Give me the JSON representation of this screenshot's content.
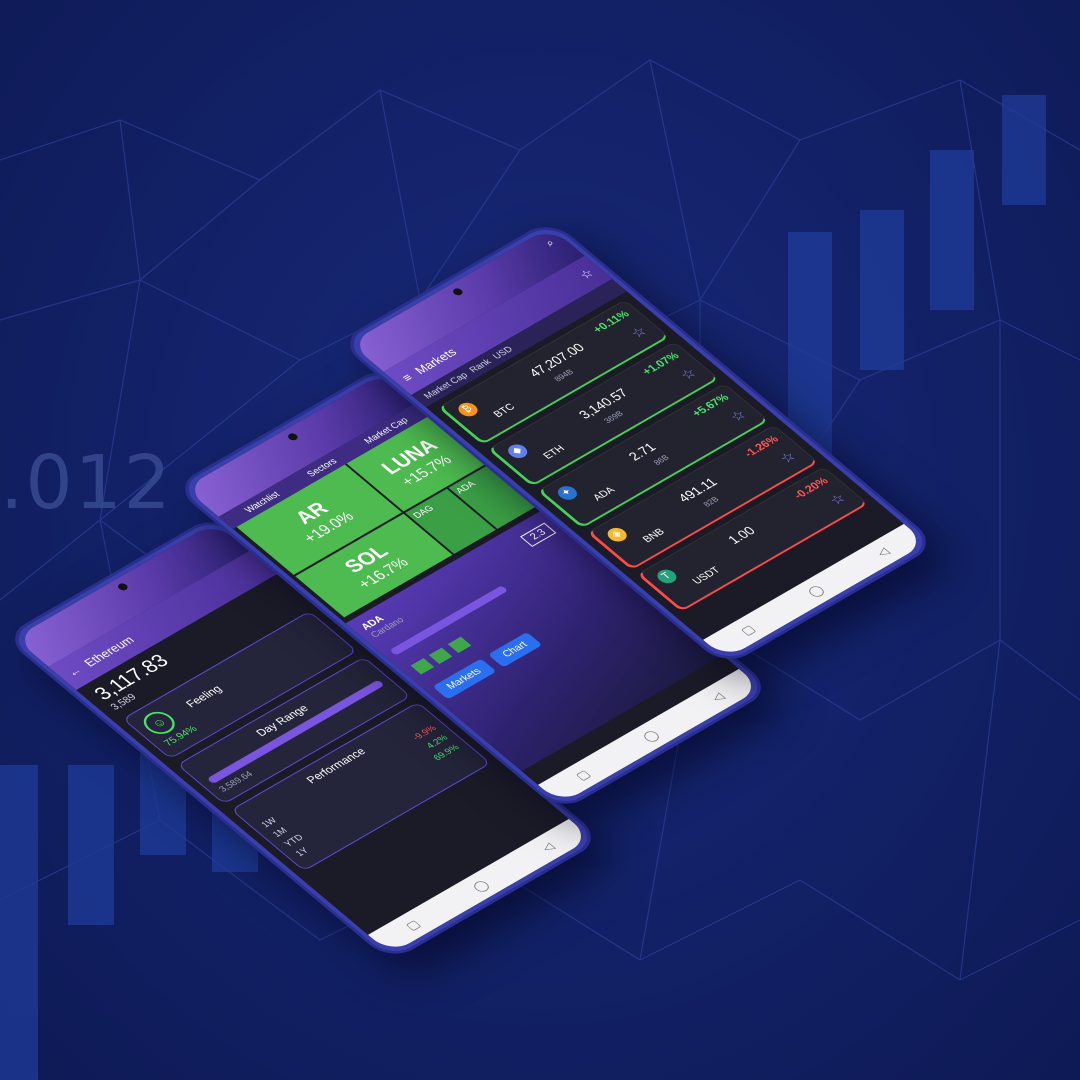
{
  "background": {
    "number_text": ".012",
    "bg_color": "#13226a",
    "line_color": "#3349a5"
  },
  "phones": {
    "left": {
      "title": "Ethereum",
      "price": "3,117.83",
      "price_sub": "3,589",
      "feeling_label": "Feeling",
      "feeling_percent": "75.94%",
      "day_range_label": "Day Range",
      "day_range_low": "3,589.64",
      "performance_label": "Performance",
      "perf_rows": [
        {
          "label": "1W",
          "value": "-9.9%"
        },
        {
          "label": "1M",
          "value": "4.2%"
        },
        {
          "label": "YTD",
          "value": "69.9%"
        },
        {
          "label": "1Y",
          "value": ""
        }
      ]
    },
    "middle": {
      "tabs": [
        "Watchlist",
        "Sectors",
        "Market Cap"
      ],
      "tiles": [
        {
          "symbol": "AR",
          "change": "+19.0%"
        },
        {
          "symbol": "LUNA",
          "change": "+15.7%"
        },
        {
          "symbol": "SOL",
          "change": "+16.7%"
        }
      ],
      "small_tiles": [
        "DAG",
        "ADA"
      ],
      "asset_symbol": "ADA",
      "asset_name": "Cardano",
      "asset_value": "2.3",
      "buttons": [
        "Markets",
        "Chart"
      ]
    },
    "right": {
      "title": "Markets",
      "filters": [
        "Market Cap",
        "Rank",
        "USD"
      ],
      "coins": [
        {
          "symbol": "BTC",
          "icon_color": "#f7931a",
          "icon_glyph": "₿",
          "price": "47,207.00",
          "cap": "894B",
          "change": "+0.11%",
          "trend": "up"
        },
        {
          "symbol": "ETH",
          "icon_color": "#627eea",
          "icon_glyph": "◆",
          "price": "3,140.57",
          "cap": "369B",
          "change": "+1.07%",
          "trend": "up"
        },
        {
          "symbol": "ADA",
          "icon_color": "#2a71d0",
          "icon_glyph": "✦",
          "price": "2.71",
          "cap": "86B",
          "change": "+5.67%",
          "trend": "up"
        },
        {
          "symbol": "BNB",
          "icon_color": "#f3ba2f",
          "icon_glyph": "◈",
          "price": "491.11",
          "cap": "82B",
          "change": "-1.26%",
          "trend": "down"
        },
        {
          "symbol": "USDT",
          "icon_color": "#26a17b",
          "icon_glyph": "T",
          "price": "1.00",
          "cap": "",
          "change": "-0.20%",
          "trend": "down"
        }
      ]
    }
  }
}
